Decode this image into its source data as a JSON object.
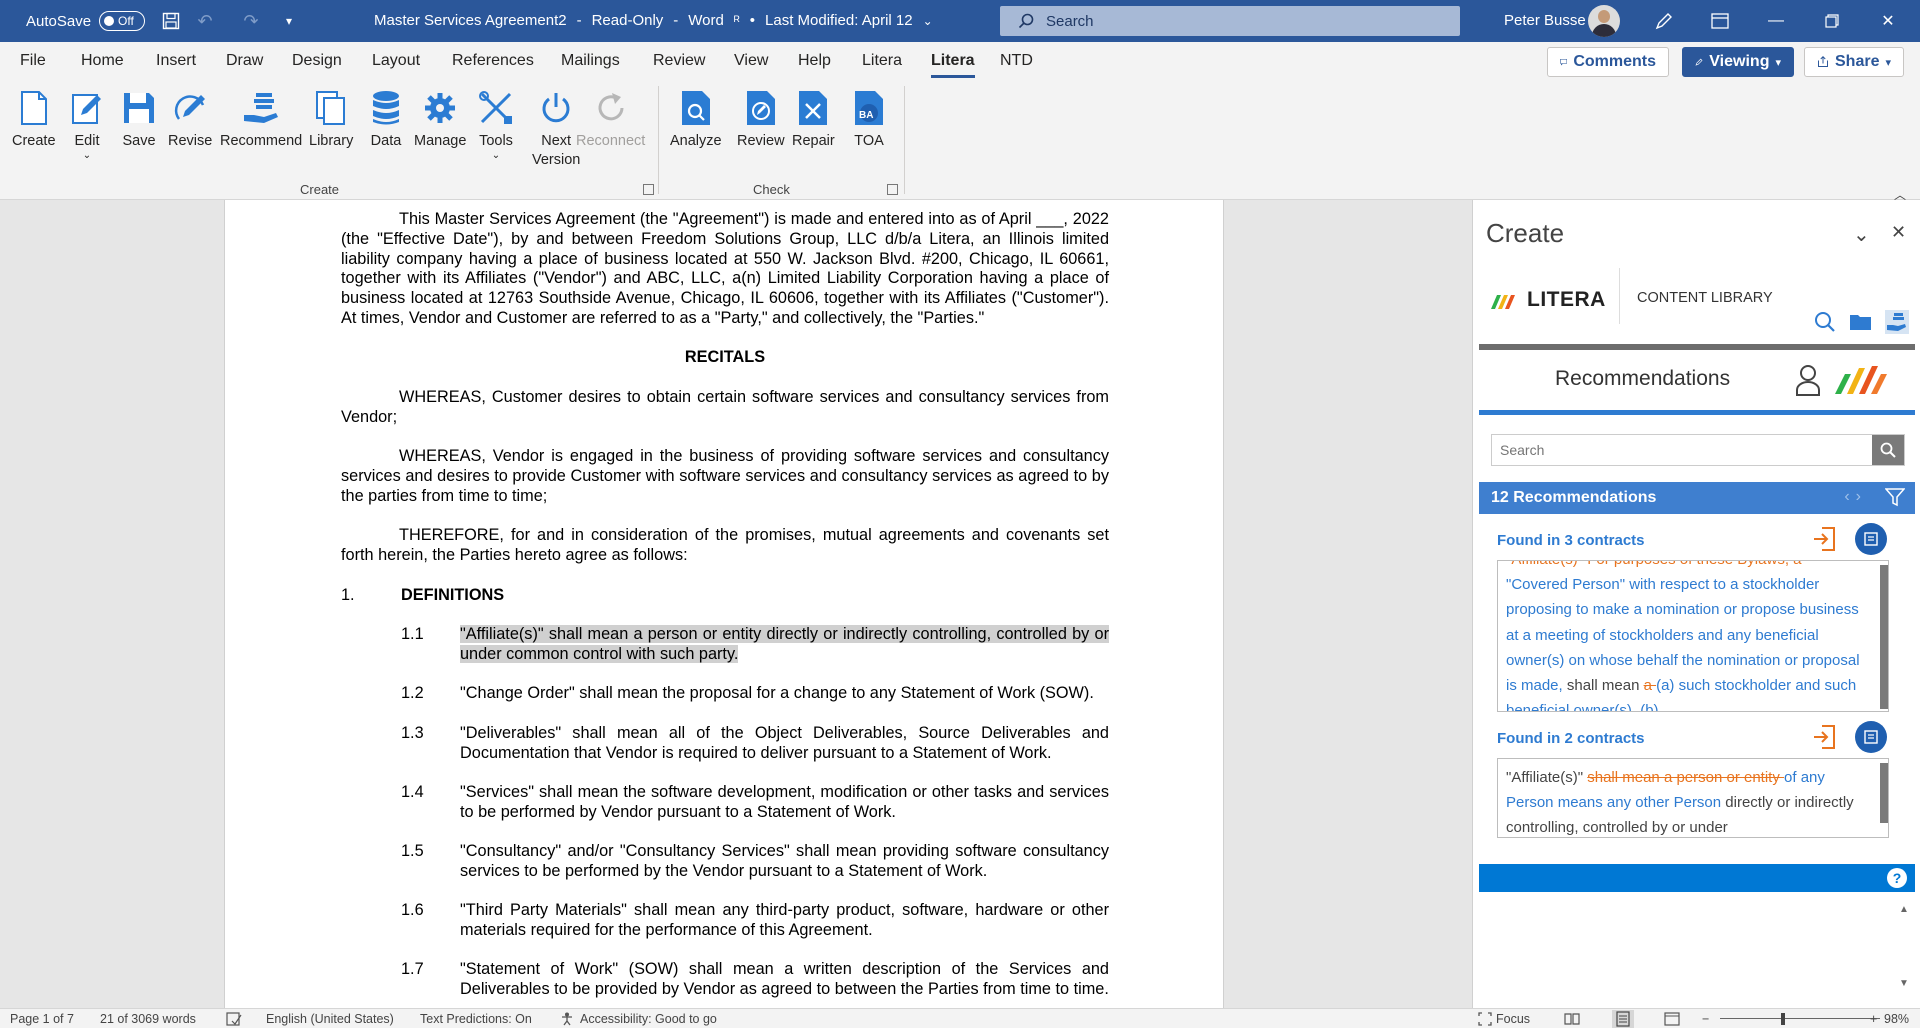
{
  "titlebar": {
    "autosave_label": "AutoSave",
    "autosave_state": "Off",
    "doc_name": "Master Services Agreement2",
    "sep1": "-",
    "mode": "Read-Only",
    "sep2": "-",
    "app": "Word",
    "last_modified": "Last Modified: April 12",
    "search_placeholder": "Search",
    "user_name": "Peter Busse"
  },
  "tabs": [
    "File",
    "Home",
    "Insert",
    "Draw",
    "Design",
    "Layout",
    "References",
    "Mailings",
    "Review",
    "View",
    "Help",
    "Litera",
    "Litera",
    "NTD"
  ],
  "header_buttons": {
    "comments": "Comments",
    "viewing": "Viewing",
    "share": "Share"
  },
  "ribbon": {
    "create_buttons": [
      "Create",
      "Edit",
      "Save",
      "Revise",
      "Recommend",
      "Library",
      "Data",
      "Manage",
      "Tools",
      "Next",
      "Reconnect"
    ],
    "next_second_line": "Version",
    "check_buttons": [
      "Analyze",
      "Review",
      "Repair",
      "TOA"
    ],
    "toa_badge": "BA",
    "group_create": "Create",
    "group_check": "Check"
  },
  "document": {
    "intro": "This Master Services Agreement (the \"Agreement\") is made and entered into as of April ___, 2022 (the \"Effective Date\"), by and between Freedom Solutions Group, LLC d/b/a Litera, an Illinois limited liability company having a place of business located at 550 W. Jackson Blvd. #200, Chicago, IL 60661, together with its Affiliates (\"Vendor\") and ABC, LLC, a(n) Limited Liability Corporation having a place of business located at 12763 Southside Avenue, Chicago, IL 60606, together with its Affiliates (\"Customer\"). At times, Vendor and Customer are referred to as a \"Party,\" and collectively, the \"Parties.\"",
    "recitals_heading": "RECITALS",
    "whereas1": "WHEREAS, Customer desires to obtain certain software services and consultancy services from Vendor;",
    "whereas2": "WHEREAS, Vendor is engaged in the business of providing software services and consultancy services and desires to provide Customer with software services and consultancy services as agreed to by the parties from time to time;",
    "therefore": "THEREFORE, for and in consideration of the promises, mutual agreements and covenants set forth herein, the Parties hereto agree as follows:",
    "section_num": "1.",
    "section_title": "DEFINITIONS",
    "definitions": [
      {
        "num": "1.1",
        "text": "\"Affiliate(s)\" shall mean a person or entity directly or indirectly controlling, controlled by or under common control with such party."
      },
      {
        "num": "1.2",
        "text": "\"Change Order\" shall mean the proposal for a change to any Statement of Work (SOW)."
      },
      {
        "num": "1.3",
        "text": "\"Deliverables\" shall mean all of the Object Deliverables, Source Deliverables and Documentation that Vendor is required to deliver pursuant to a Statement of Work."
      },
      {
        "num": "1.4",
        "text": "\"Services\" shall mean the software development, modification or other tasks and services to be performed by Vendor pursuant to a Statement of Work."
      },
      {
        "num": "1.5",
        "text": "\"Consultancy\" and/or \"Consultancy Services\" shall mean providing software consultancy services to be performed by the Vendor pursuant to a Statement of Work."
      },
      {
        "num": "1.6",
        "text": "\"Third Party Materials\" shall mean any third-party product, software, hardware or other materials required for the performance of this Agreement."
      },
      {
        "num": "1.7",
        "text": "\"Statement of Work\" (SOW) shall mean a written description of the Services and Deliverables to be provided by Vendor as agreed to between the Parties from time to time."
      }
    ]
  },
  "pane": {
    "title": "Create",
    "brand": "LITERA",
    "content_library": "CONTENT LIBRARY",
    "recommendations_title": "Recommendations",
    "search_placeholder": "Search",
    "count": "12 Recommendations",
    "results": [
      {
        "found": "Found in 3 contracts",
        "lead_struck": "\"Affiliate(s)\" For purposes of these Bylaws, a",
        "ins1": "\"Covered Person\" with respect to a stockholder proposing to make a nomination or propose business at a meeting of stockholders and any beneficial owner(s) on whose behalf the nomination or proposal is made,",
        "plain": " shall mean ",
        "del": "a ",
        "ins2": "(a) such stockholder and such beneficial owner(s), (b)"
      },
      {
        "found": "Found in 2 contracts",
        "plain1": "\"Affiliate(s)\" ",
        "del": "shall mean a person or entity ",
        "ins": "of any Person means any other Person",
        "plain2": " directly or indirectly controlling, controlled by or under"
      }
    ]
  },
  "statusbar": {
    "page": "Page 1 of 7",
    "words": "21 of 3069 words",
    "language": "English (United States)",
    "predictions": "Text Predictions: On",
    "accessibility": "Accessibility: Good to go",
    "focus": "Focus",
    "zoom_minus": "−",
    "zoom_plus": "+",
    "zoom": "98%"
  },
  "colors": {
    "titlebar": "#2b579a",
    "accent_blue": "#2e7bd1",
    "deleted_orange": "#e8741f"
  }
}
